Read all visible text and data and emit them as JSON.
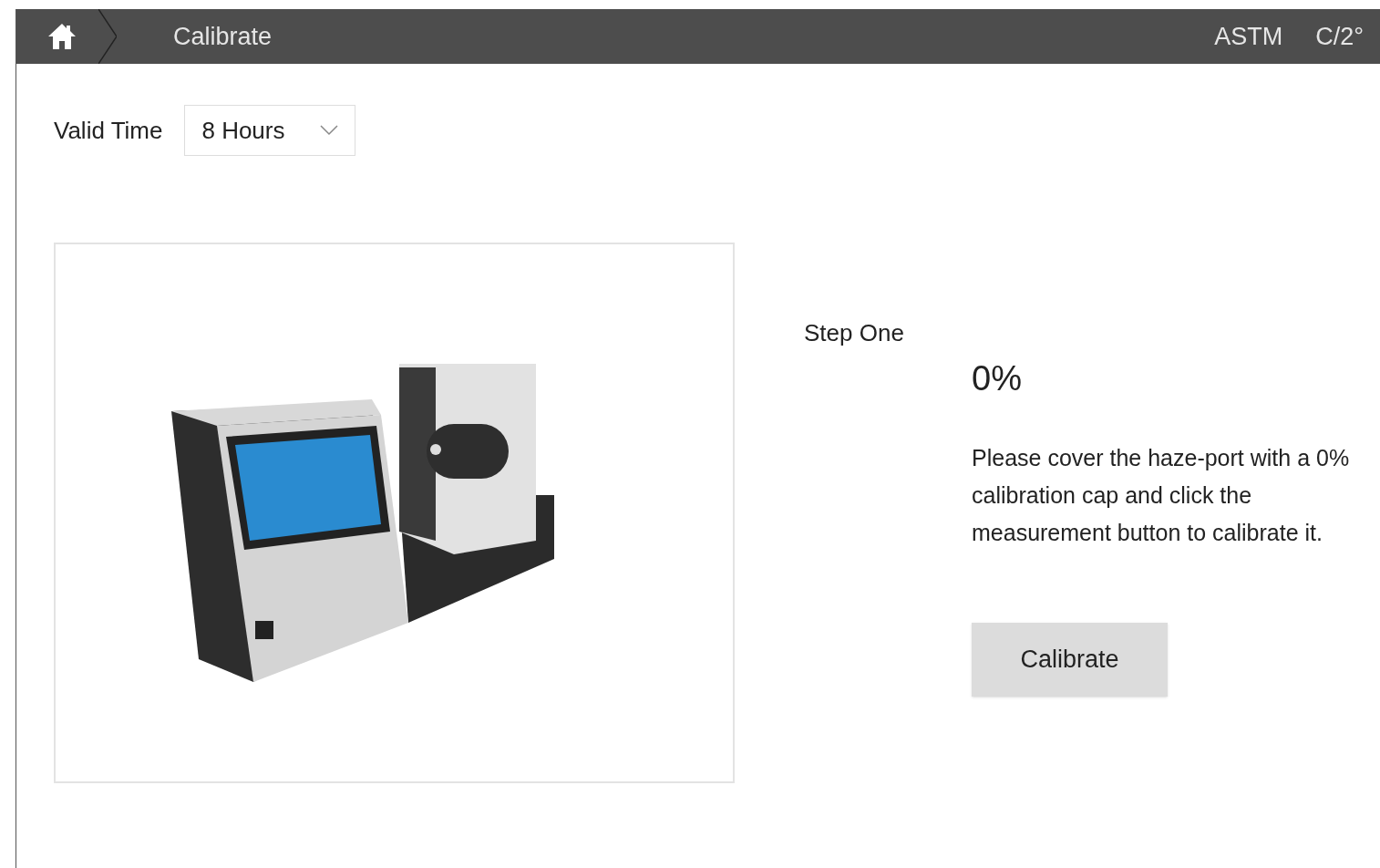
{
  "header": {
    "title": "Calibrate",
    "standard": "ASTM",
    "illuminant": "C/2°"
  },
  "valid_time": {
    "label": "Valid Time",
    "value": "8 Hours"
  },
  "step": {
    "label": "Step One",
    "value": "0%",
    "instruction": "Please cover the haze-port with a 0% calibration cap and click the measurement button to calibrate it."
  },
  "button": "Calibrate"
}
